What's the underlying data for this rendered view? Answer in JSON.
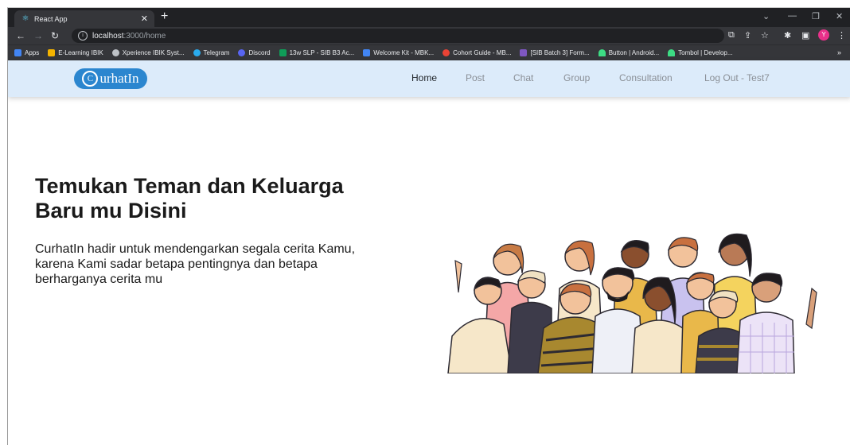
{
  "browser": {
    "tab_title": "React App",
    "url_host": "localhost",
    "url_rest": ":3000/home",
    "profile_initial": "Y",
    "bookmarks": [
      {
        "label": "Apps",
        "color": "#4285f4"
      },
      {
        "label": "E-Learning IBIK",
        "color": "#f4b400"
      },
      {
        "label": "Xperience IBIK Syst...",
        "color": "#bdc1c6"
      },
      {
        "label": "Telegram",
        "color": "#2aabee"
      },
      {
        "label": "Discord",
        "color": "#5865f2"
      },
      {
        "label": "13w SLP - SIB B3 Ac...",
        "color": "#0f9d58"
      },
      {
        "label": "Welcome Kit - MBK...",
        "color": "#4285f4"
      },
      {
        "label": "Cohort Guide - MB...",
        "color": "#ea4335"
      },
      {
        "label": "[SIB Batch 3] Form...",
        "color": "#7e57c2"
      },
      {
        "label": "Button | Android...",
        "color": "#3ddc84"
      },
      {
        "label": "Tombol | Develop...",
        "color": "#3ddc84"
      }
    ],
    "bookmarks_more": "»"
  },
  "app": {
    "logo_letter": "C",
    "logo_text": "urhatIn",
    "nav": [
      {
        "label": "Home",
        "active": true
      },
      {
        "label": "Post",
        "active": false
      },
      {
        "label": "Chat",
        "active": false
      },
      {
        "label": "Group",
        "active": false
      },
      {
        "label": "Consultation",
        "active": false
      },
      {
        "label": "Log Out - Test7",
        "active": false
      }
    ],
    "hero_title_line1": "Temukan Teman dan Keluarga",
    "hero_title_line2": "Baru mu Disini",
    "hero_text_line1": "CurhatIn hadir untuk mendengarkan segala cerita Kamu,",
    "hero_text_line2": "karena Kami sadar betapa pentingnya dan betapa",
    "hero_text_line3": "berharganya cerita mu"
  },
  "colors": {
    "navbar_bg": "#dcebfa",
    "logo_bg": "#2b86cf",
    "browser_dark": "#202124"
  }
}
